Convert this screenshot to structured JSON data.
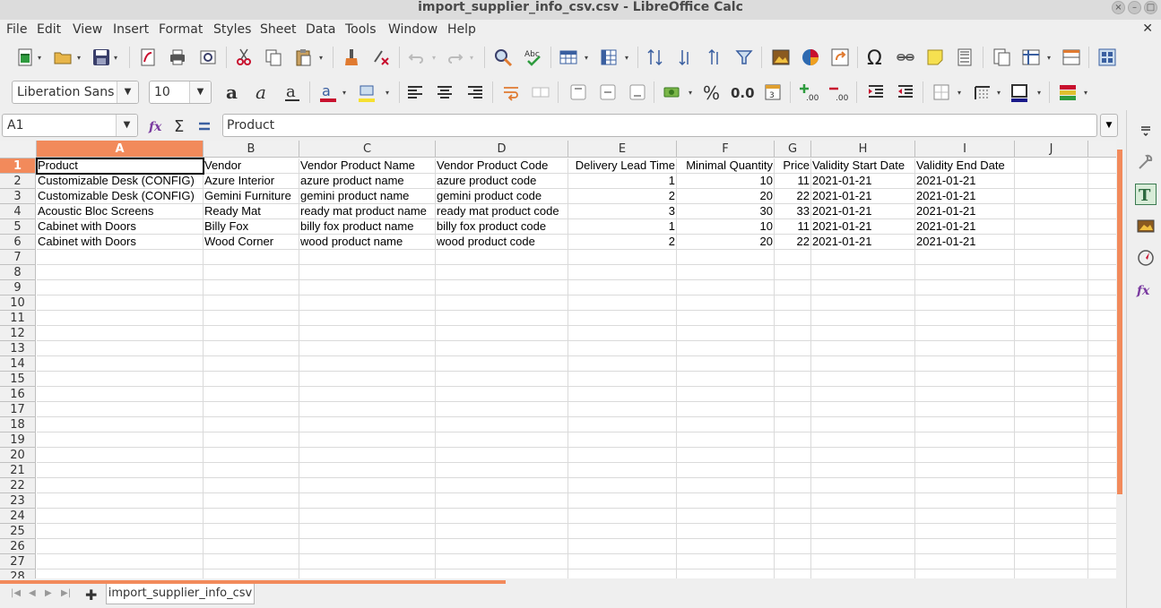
{
  "window": {
    "title": "import_supplier_info_csv.csv - LibreOffice Calc"
  },
  "menu": [
    "File",
    "Edit",
    "View",
    "Insert",
    "Format",
    "Styles",
    "Sheet",
    "Data",
    "Tools",
    "Window",
    "Help"
  ],
  "toolbar": {
    "font_name": "Liberation Sans",
    "font_size": "10",
    "percent_label": "%",
    "decimal_label": "0.0"
  },
  "formula_bar": {
    "cell_ref": "A1",
    "content": "Product"
  },
  "columns": [
    "A",
    "B",
    "C",
    "D",
    "E",
    "F",
    "G",
    "H",
    "I",
    "J"
  ],
  "rows": [
    "1",
    "2",
    "3",
    "4",
    "5",
    "6",
    "7",
    "8",
    "9",
    "10",
    "11",
    "12",
    "13",
    "14",
    "15",
    "16",
    "17",
    "18",
    "19",
    "20",
    "21",
    "22",
    "23",
    "24",
    "25",
    "26",
    "27",
    "28"
  ],
  "sheet": {
    "headers": [
      "Product",
      "Vendor",
      "Vendor Product Name",
      "Vendor Product Code",
      "Delivery Lead Time",
      "Minimal Quantity",
      "Price",
      "Validity Start Date",
      "Validity End Date"
    ],
    "data": [
      [
        "Customizable Desk (CONFIG)",
        "Azure Interior",
        "azure product name",
        "azure product code",
        "1",
        "10",
        "11",
        "2021-01-21",
        "2021-01-21"
      ],
      [
        "Customizable Desk (CONFIG)",
        "Gemini Furniture",
        "gemini product name",
        "gemini product code",
        "2",
        "20",
        "22",
        "2021-01-21",
        "2021-01-21"
      ],
      [
        "Acoustic Bloc Screens",
        "Ready Mat",
        "ready mat product name",
        "ready mat product code",
        "3",
        "30",
        "33",
        "2021-01-21",
        "2021-01-21"
      ],
      [
        "Cabinet with Doors",
        "Billy Fox",
        "billy fox product name",
        "billy fox product code",
        "1",
        "10",
        "11",
        "2021-01-21",
        "2021-01-21"
      ],
      [
        "Cabinet with Doors",
        "Wood Corner",
        "wood product name",
        "wood product code",
        "2",
        "20",
        "22",
        "2021-01-21",
        "2021-01-21"
      ]
    ]
  },
  "sheet_tabs": [
    "import_supplier_info_csv"
  ],
  "colors": {
    "accent": "#f28a5b",
    "header_bg": "#f0f0f0"
  }
}
